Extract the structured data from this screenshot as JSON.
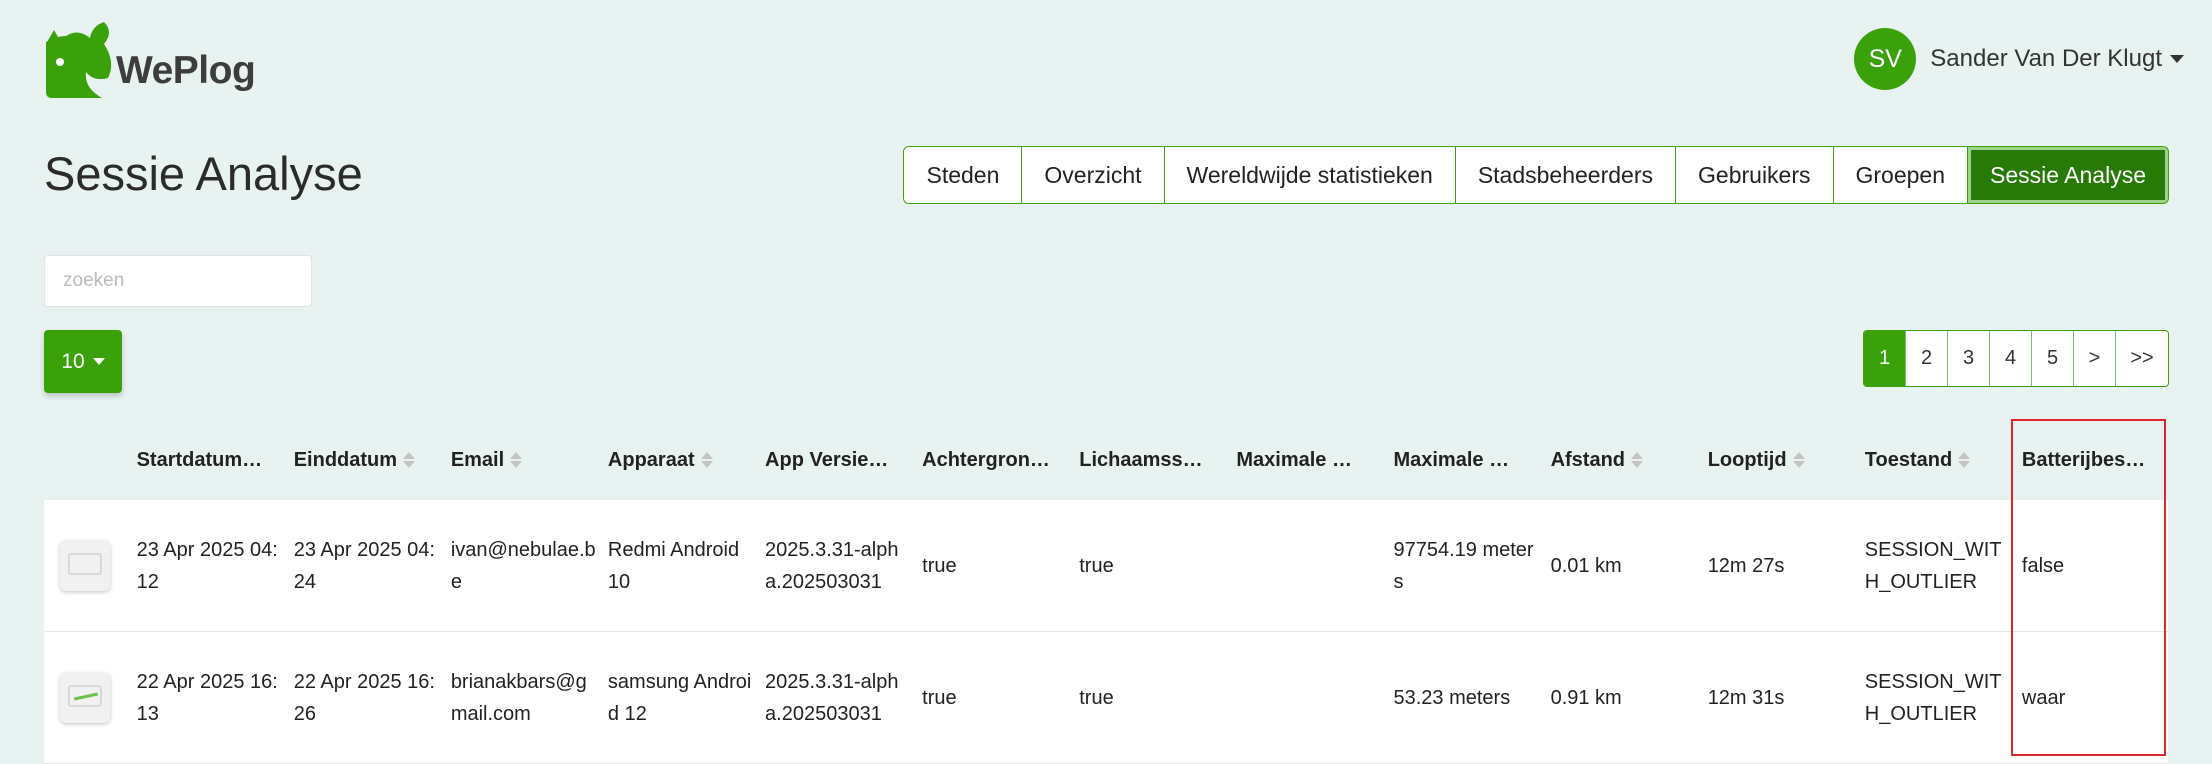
{
  "brand": {
    "name": "WePlog",
    "color": "#3aa10a"
  },
  "user": {
    "initials": "SV",
    "name": "Sander Van Der Klugt"
  },
  "page_title": "Sessie Analyse",
  "nav": [
    {
      "label": "Steden",
      "active": false
    },
    {
      "label": "Overzicht",
      "active": false
    },
    {
      "label": "Wereldwijde statistieken",
      "active": false
    },
    {
      "label": "Stadsbeheerders",
      "active": false
    },
    {
      "label": "Gebruikers",
      "active": false
    },
    {
      "label": "Groepen",
      "active": false
    },
    {
      "label": "Sessie Analyse",
      "active": true
    }
  ],
  "search": {
    "placeholder": "zoeken",
    "value": ""
  },
  "page_size": "10",
  "pagination": {
    "pages": [
      "1",
      "2",
      "3",
      "4",
      "5"
    ],
    "current": "1",
    "next": ">",
    "last": ">>"
  },
  "table": {
    "columns": [
      {
        "label": "",
        "sortable": false
      },
      {
        "label": "Startdatum…",
        "sortable": false
      },
      {
        "label": "Einddatum",
        "sortable": true
      },
      {
        "label": "Email",
        "sortable": true
      },
      {
        "label": "Apparaat",
        "sortable": true
      },
      {
        "label": "App Versie…",
        "sortable": false
      },
      {
        "label": "Achtergron…",
        "sortable": false
      },
      {
        "label": "Lichaamss…",
        "sortable": false
      },
      {
        "label": "Maximale …",
        "sortable": false
      },
      {
        "label": "Maximale …",
        "sortable": false
      },
      {
        "label": "Afstand",
        "sortable": true
      },
      {
        "label": "Looptijd",
        "sortable": true
      },
      {
        "label": "Toestand",
        "sortable": true
      },
      {
        "label": "Batterijbes…",
        "sortable": false
      }
    ],
    "rows": [
      {
        "start": "23 Apr 2025 04:12",
        "end": "23 Apr 2025 04:24",
        "email": "ivan@nebulae.be",
        "device": "Redmi Android 10",
        "app_version": "2025.3.31-alpha.202503031",
        "background": "true",
        "body": "true",
        "max1": "",
        "max2": "97754.19 meters",
        "distance": "0.01 km",
        "duration": "12m 27s",
        "state": "SESSION_WITH_OUTLIER",
        "battery": "false"
      },
      {
        "start": "22 Apr 2025 16:13",
        "end": "22 Apr 2025 16:26",
        "email": "brianakbars@gmail.com",
        "device": "samsung Android 12",
        "app_version": "2025.3.31-alpha.202503031",
        "background": "true",
        "body": "true",
        "max1": "",
        "max2": "53.23 meters",
        "distance": "0.91 km",
        "duration": "12m 31s",
        "state": "SESSION_WITH_OUTLIER",
        "battery": "waar"
      }
    ]
  }
}
